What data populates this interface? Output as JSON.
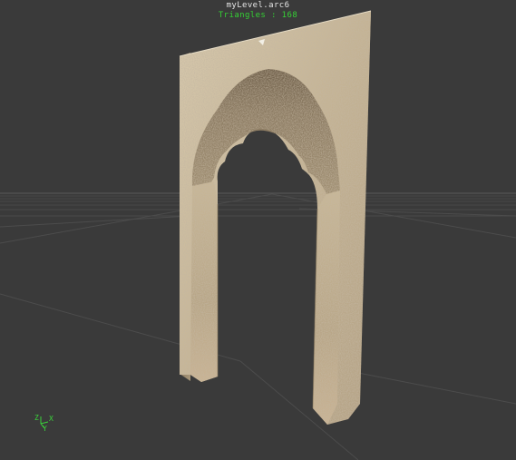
{
  "viewport": {
    "filename": "myLevel.arc6",
    "triangles_label": "Triangles : 168"
  },
  "axis_gizmo": {
    "z_label": "Z",
    "x_label": "X",
    "y_label": "Y"
  },
  "colors": {
    "background": "#3a3a3a",
    "grid_line": "#4c4c4c",
    "hud_text": "#e6e6e6",
    "stats_text": "#35d035",
    "axis_gizmo": "#3ad33a",
    "stone_light": "#d2c3a6",
    "stone_dark": "#5c4e3a"
  }
}
